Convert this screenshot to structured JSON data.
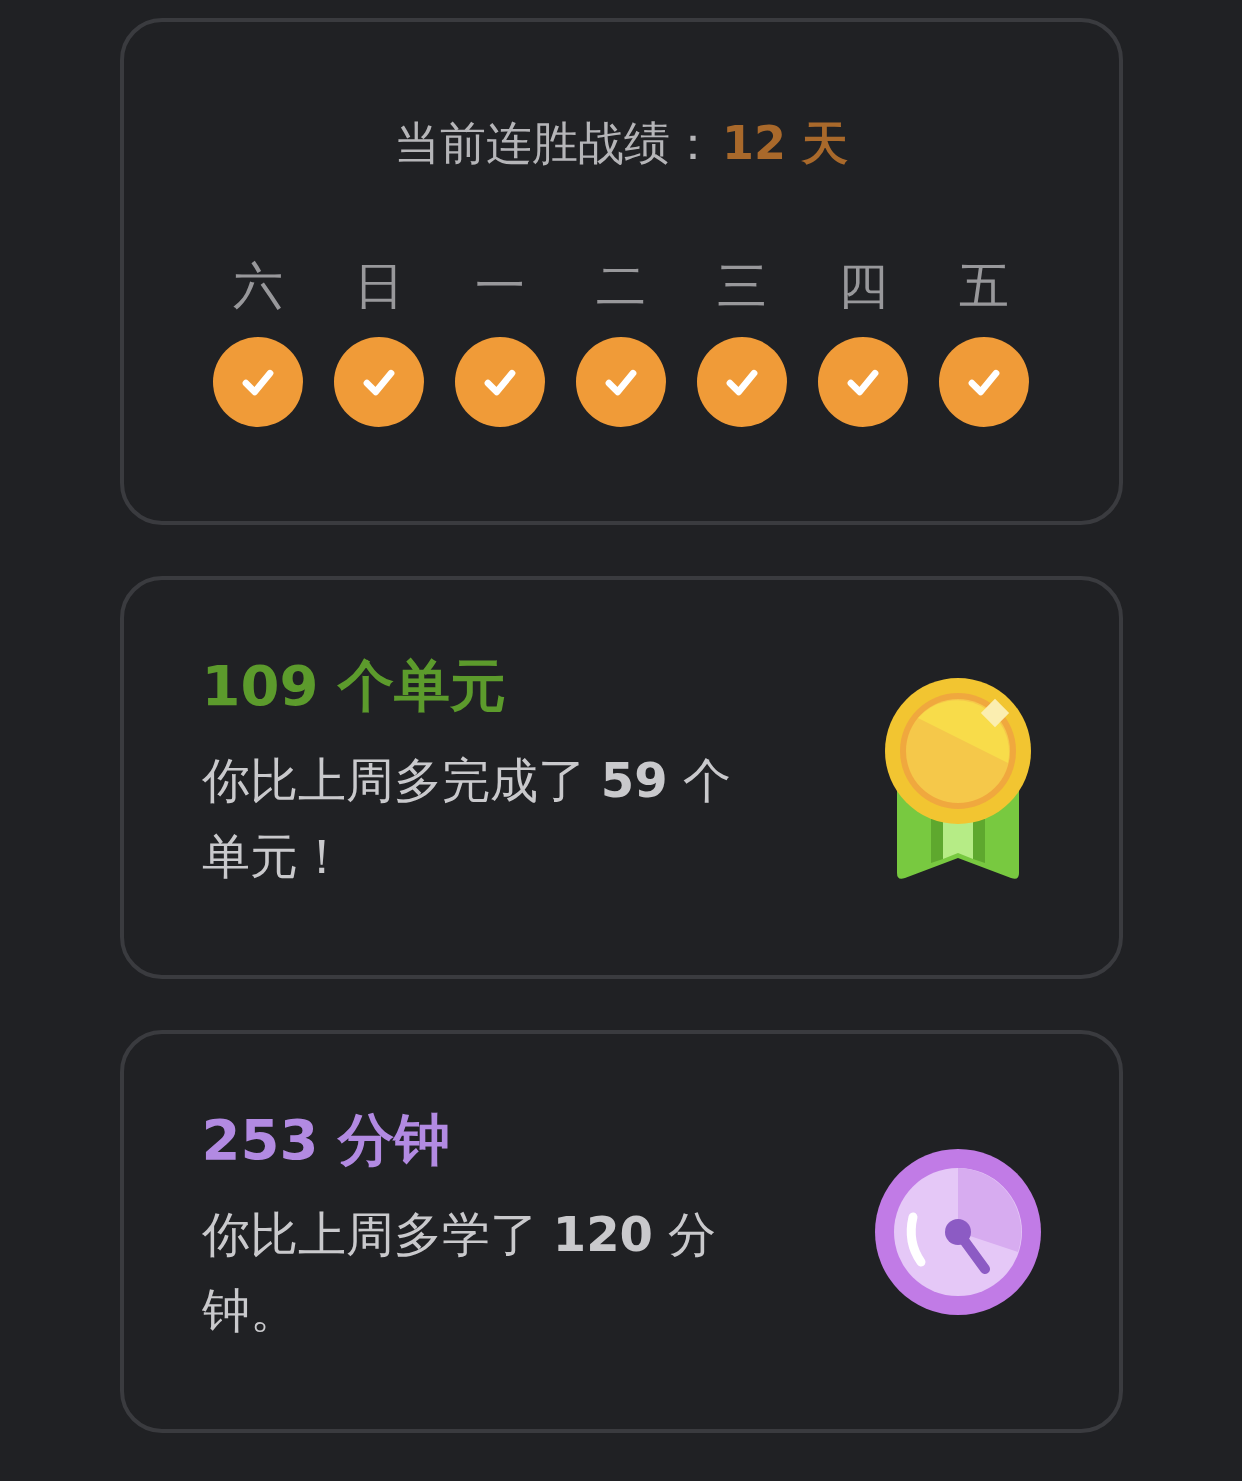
{
  "streak": {
    "label": "当前连胜战绩：",
    "value": "12 天",
    "days": [
      {
        "label": "六",
        "checked": true
      },
      {
        "label": "日",
        "checked": true
      },
      {
        "label": "一",
        "checked": true
      },
      {
        "label": "二",
        "checked": true
      },
      {
        "label": "三",
        "checked": true
      },
      {
        "label": "四",
        "checked": true
      },
      {
        "label": "五",
        "checked": true
      }
    ]
  },
  "stats": [
    {
      "kind": "medal",
      "headline": "109 个单元",
      "text": "你比上周多完成了 **59** 个单元！"
    },
    {
      "kind": "clock",
      "headline": "253 分钟",
      "text": "你比上周多学了 **120** 分钟。"
    }
  ]
}
